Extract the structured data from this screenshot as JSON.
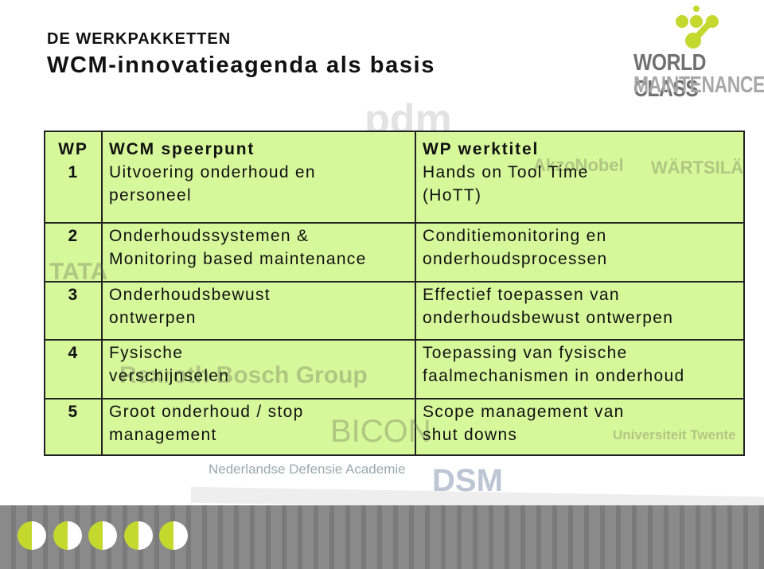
{
  "header": {
    "supertitle": "DE WERKPAKKETTEN",
    "title": "WCM-innovatieagenda als basis"
  },
  "logo": {
    "line1": "WORLD CLASS",
    "line2": "MAINTENANCE",
    "accent": "#c4d82e"
  },
  "background_logos": [
    "pdm",
    "AkzoNobel",
    "WÄRTSILÄ",
    "Rexroth Bosch Group",
    "BICON",
    "Nederlandse Defensie Academie",
    "DSM",
    "Universiteit Twente",
    "TATA"
  ],
  "table": {
    "headers": [
      "WP",
      "WCM speerpunt",
      "WP werktitel"
    ],
    "rows": [
      {
        "wp": "1",
        "speerpunt": [
          "Uitvoering onderhoud en",
          "personeel"
        ],
        "werktitel": [
          "Hands on Tool Time",
          "(HoTT)"
        ]
      },
      {
        "wp": "2",
        "speerpunt": [
          "Onderhoudssystemen &",
          "Monitoring based maintenance"
        ],
        "werktitel": [
          "Conditiemonitoring en",
          "onderhoudsprocessen"
        ]
      },
      {
        "wp": "3",
        "speerpunt": [
          "Onderhoudsbewust",
          "ontwerpen"
        ],
        "werktitel": [
          "Effectief toepassen van",
          "onderhoudsbewust ontwerpen"
        ]
      },
      {
        "wp": "4",
        "speerpunt": [
          "Fysische",
          "verschijnselen"
        ],
        "werktitel": [
          "Toepassing van fysische",
          "faalmechanismen in onderhoud"
        ]
      },
      {
        "wp": "5",
        "speerpunt": [
          "Groot onderhoud / stop",
          "management"
        ],
        "werktitel": [
          "Scope management van",
          "shut downs"
        ]
      }
    ],
    "background": "#d7f79b"
  },
  "footer_icons": [
    "airplane-icon",
    "turbine-icon",
    "plug-icon",
    "factory-icon",
    "satellite-icon"
  ]
}
